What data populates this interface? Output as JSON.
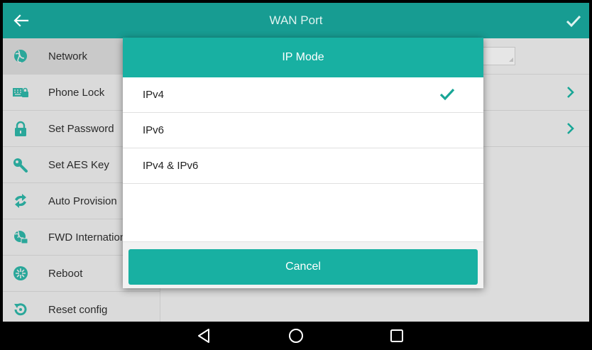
{
  "titlebar": {
    "title": "WAN Port",
    "back_icon": "arrow-left-icon",
    "confirm_icon": "checkmark-icon"
  },
  "sidebar": {
    "items": [
      {
        "label": "Network",
        "icon": "globe-network-icon",
        "color": "#2aa79a",
        "active": true
      },
      {
        "label": "Phone Lock",
        "icon": "keyboard-lock-icon",
        "color": "#2aa79a"
      },
      {
        "label": "Set Password",
        "icon": "padlock-icon",
        "color": "#2aa79a"
      },
      {
        "label": "Set AES Key",
        "icon": "key-icon",
        "color": "#2aa79a"
      },
      {
        "label": "Auto Provision",
        "icon": "sync-arrows-icon",
        "color": "#2aa79a"
      },
      {
        "label": "FWD International",
        "icon": "globe-phone-icon",
        "color": "#2aa79a"
      },
      {
        "label": "Reboot",
        "icon": "reboot-icon",
        "color": "#2aa79a"
      },
      {
        "label": "Reset config",
        "icon": "reset-icon",
        "color": "#2aa79a"
      }
    ]
  },
  "dialog": {
    "title": "IP Mode",
    "options": [
      {
        "label": "IPv4",
        "selected": true
      },
      {
        "label": "IPv6",
        "selected": false
      },
      {
        "label": "IPv4 & IPv6",
        "selected": false
      }
    ],
    "cancel_label": "Cancel"
  },
  "navbar": {
    "back": "triangle-back-icon",
    "home": "circle-home-icon",
    "recents": "square-recents-icon"
  },
  "colors": {
    "accent": "#18b0a2",
    "titlebar": "#179c92",
    "check": "#18a696"
  }
}
